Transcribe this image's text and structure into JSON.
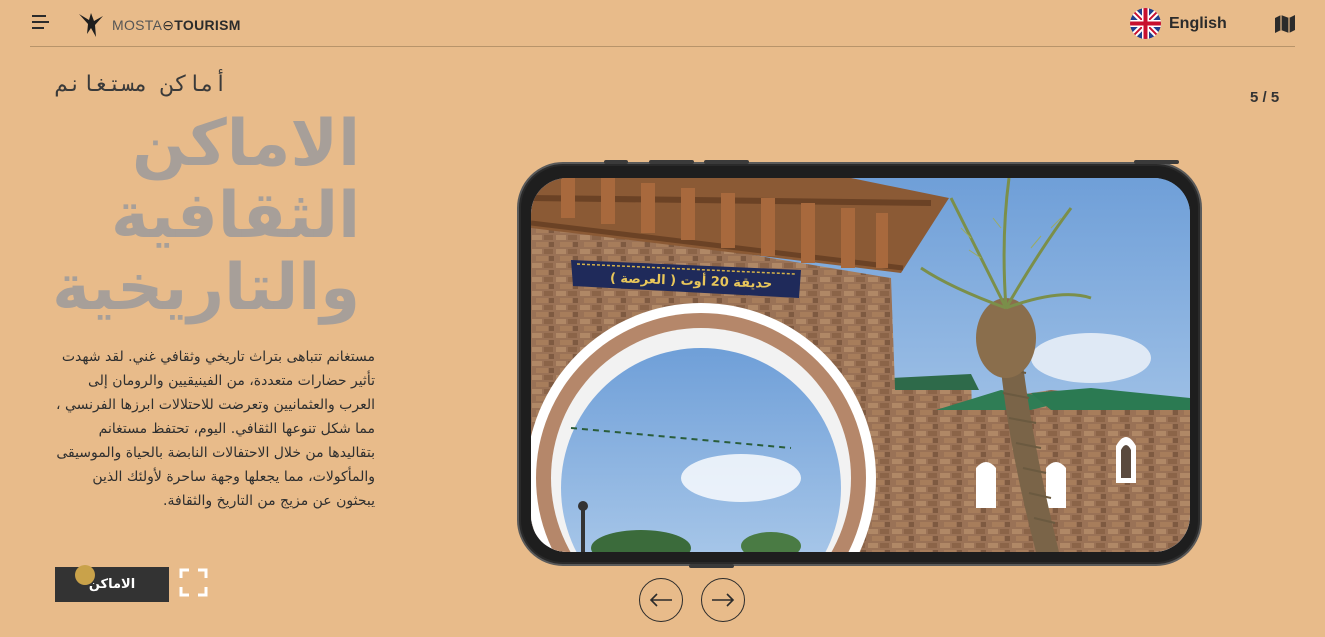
{
  "header": {
    "logo_text_light": "MOSTA",
    "logo_text_bold": "TOURISM",
    "language_label": "English",
    "icons": [
      "menu-icon",
      "logo-bird-icon",
      "uk-flag-icon",
      "map-icon"
    ]
  },
  "hero": {
    "subtitle": "أماكن مستغانم",
    "headline_lines": [
      "الاماكن",
      "الثقافية",
      "والتاريخية"
    ],
    "paragraph": "مستغانم تتباهى بتراث تاريخي وثقافي غني. لقد شهدت تأثير حضارات متعددة، من الفينيقيين والرومان إلى العرب والعثمانيين وتعرضت للاحتلالات ابرزها الفرنسي ، مما شكل تنوعها الثقافي. اليوم، تحتفظ مستغانم بتقاليدها من خلال الاحتفالات النابضة بالحياة والموسيقى والمأكولات، مما يجعلها وجهة ساحرة لأولئك الذين يبحثون عن مزيج من التاريخ والثقافة.",
    "places_button": "الاماكن",
    "fullscreen_icon": "fullscreen-icon"
  },
  "slider": {
    "counter": "5 / 5",
    "sign_text": "حديقة 20 أوت ( العرصة )",
    "prev_icon": "arrow-left-icon",
    "next_icon": "arrow-right-icon"
  },
  "colors": {
    "background": "#e8bb8a",
    "headline": "#a79f99",
    "button": "#333333",
    "accent_dot": "#c9a24a"
  }
}
